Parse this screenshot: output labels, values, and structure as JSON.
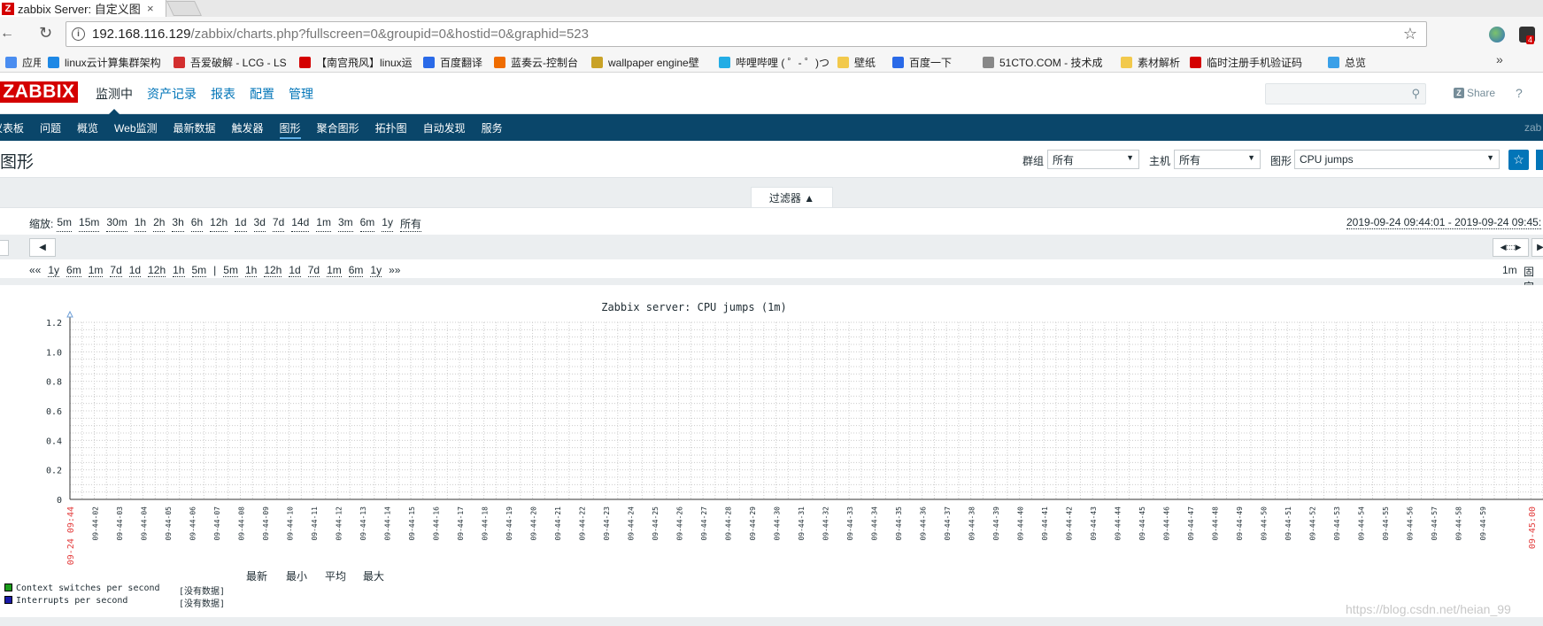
{
  "browser": {
    "tab_title": "zabbix Server: 自定义图",
    "tab_favicon": "Z",
    "url_host": "192.168.116.129",
    "url_path": "/zabbix/charts.php?fullscreen=0&groupid=0&hostid=0&graphid=523",
    "ext_badge": "4",
    "bookmarks": [
      {
        "label": "应用",
        "color": "#4a8df0"
      },
      {
        "label": "linux云计算集群架构",
        "color": "#1e88e5"
      },
      {
        "label": "吾爱破解 - LCG - LS",
        "color": "#d32f2f"
      },
      {
        "label": "【南宫飛风】linux运",
        "color": "#d40000"
      },
      {
        "label": "百度翻译",
        "color": "#2a6ae8"
      },
      {
        "label": "蓝奏云-控制台",
        "color": "#ef6c00"
      },
      {
        "label": "wallpaper engine壁",
        "color": "#c9a227"
      },
      {
        "label": "哔哩哔哩 ( ゜- ゜)つロ",
        "color": "#23ade5"
      },
      {
        "label": "壁纸",
        "color": "#f2c94c"
      },
      {
        "label": "百度一下",
        "color": "#2a6ae8"
      },
      {
        "label": "51CTO.COM - 技术成",
        "color": "#888888"
      },
      {
        "label": "素材解析",
        "color": "#f2c94c"
      },
      {
        "label": "临时注册手机验证码",
        "color": "#d40000"
      },
      {
        "label": "总览",
        "color": "#3aa0e8"
      }
    ],
    "bookmarks_more": "»"
  },
  "header": {
    "logo": "ZABBIX",
    "main_menu": [
      "监测中",
      "资产记录",
      "报表",
      "配置",
      "管理"
    ],
    "active_main": 0,
    "share_label": "Share",
    "help_label": "?"
  },
  "sub_menu": {
    "items": [
      "仪表板",
      "问题",
      "概览",
      "Web监测",
      "最新数据",
      "触发器",
      "图形",
      "聚合图形",
      "拓扑图",
      "自动发现",
      "服务"
    ],
    "active": 6,
    "user": "zab"
  },
  "page": {
    "title": "图形",
    "group_label": "群组",
    "group_value": "所有",
    "host_label": "主机",
    "host_value": "所有",
    "graph_label": "图形",
    "graph_value": "CPU jumps"
  },
  "filter": {
    "tab_label": "过滤器 ▲",
    "zoom_label": "缩放:",
    "zoom_options": [
      "5m",
      "15m",
      "30m",
      "1h",
      "2h",
      "3h",
      "6h",
      "12h",
      "1d",
      "3d",
      "7d",
      "14d",
      "1m",
      "3m",
      "6m",
      "1y",
      "所有"
    ],
    "range": "2019-09-24 09:44:01 - 2019-09-24 09:45:",
    "nav_back": [
      "1y",
      "6m",
      "1m",
      "7d",
      "1d",
      "12h",
      "1h",
      "5m"
    ],
    "nav_forward": [
      "5m",
      "1h",
      "12h",
      "1d",
      "7d",
      "1m",
      "6m",
      "1y"
    ],
    "nav_first": "««",
    "nav_last": "»»",
    "nav_sep": "|",
    "period": "1m",
    "fixed": "固定"
  },
  "colors": {
    "series1": "#1a9c1a",
    "series2": "#1a1aa8",
    "axis_red": "#e33d3d",
    "grid": "#cccccc"
  },
  "chart_data": {
    "type": "line",
    "title": "Zabbix server: CPU jumps (1m)",
    "ylim": [
      0,
      1.2
    ],
    "y_ticks": [
      "0",
      "0.2",
      "0.4",
      "0.6",
      "0.8",
      "1.0",
      "1.2"
    ],
    "x_start_label": "09-24 09:44",
    "x_end_label": "09-45:00",
    "x_ticks": [
      "09:44:02",
      "09:44:03",
      "09:44:04",
      "09:44:05",
      "09:44:06",
      "09:44:07",
      "09:44:08",
      "09:44:09",
      "09:44:10",
      "09:44:11",
      "09:44:12",
      "09:44:13",
      "09:44:14",
      "09:44:15",
      "09:44:16",
      "09:44:17",
      "09:44:18",
      "09:44:19",
      "09:44:20",
      "09:44:21",
      "09:44:22",
      "09:44:23",
      "09:44:24",
      "09:44:25",
      "09:44:26",
      "09:44:27",
      "09:44:28",
      "09:44:29",
      "09:44:30",
      "09:44:31",
      "09:44:32",
      "09:44:33",
      "09:44:34",
      "09:44:35",
      "09:44:36",
      "09:44:37",
      "09:44:38",
      "09:44:39",
      "09:44:40",
      "09:44:41",
      "09:44:42",
      "09:44:43",
      "09:44:44",
      "09:44:45",
      "09:44:46",
      "09:44:47",
      "09:44:48",
      "09:44:49",
      "09:44:50",
      "09:44:51",
      "09:44:52",
      "09:44:53",
      "09:44:54",
      "09:44:55",
      "09:44:56",
      "09:44:57",
      "09:44:58",
      "09:44:59"
    ],
    "legend_headers": [
      "最新",
      "最小",
      "平均",
      "最大"
    ],
    "series": [
      {
        "name": "Context switches per second",
        "status": "[没有数据]",
        "values": []
      },
      {
        "name": "Interrupts per second",
        "status": "[没有数据]",
        "values": []
      }
    ],
    "grid": true
  },
  "watermark": "https://blog.csdn.net/heian_99"
}
